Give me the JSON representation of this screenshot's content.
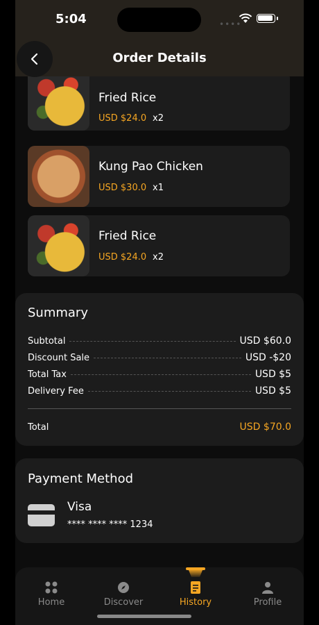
{
  "status": {
    "time": "5:04"
  },
  "header": {
    "title": "Order Details"
  },
  "items": [
    {
      "name": "Fried Rice",
      "price": "USD $24.0",
      "qty": "x2",
      "image": "fried-rice"
    },
    {
      "name": "Kung Pao Chicken",
      "price": "USD $30.0",
      "qty": "x1",
      "image": "pizza"
    },
    {
      "name": "Fried Rice",
      "price": "USD $24.0",
      "qty": "x2",
      "image": "fried-rice"
    }
  ],
  "summary": {
    "title": "Summary",
    "rows": [
      {
        "label": "Subtotal",
        "value": "USD $60.0"
      },
      {
        "label": "Discount Sale",
        "value": "USD -$20"
      },
      {
        "label": "Total Tax",
        "value": "USD $5"
      },
      {
        "label": "Delivery Fee",
        "value": "USD $5"
      }
    ],
    "total_label": "Total",
    "total_value": "USD $70.0"
  },
  "payment": {
    "title": "Payment Method",
    "method": "Visa",
    "card_number": "**** **** **** 1234"
  },
  "nav": [
    {
      "label": "Home",
      "icon": "grid-icon",
      "active": false
    },
    {
      "label": "Discover",
      "icon": "compass-icon",
      "active": false
    },
    {
      "label": "History",
      "icon": "receipt-icon",
      "active": true
    },
    {
      "label": "Profile",
      "icon": "user-icon",
      "active": false
    }
  ],
  "colors": {
    "accent": "#f5a623",
    "background": "#0d0d0d",
    "card": "#1c1c1c"
  }
}
